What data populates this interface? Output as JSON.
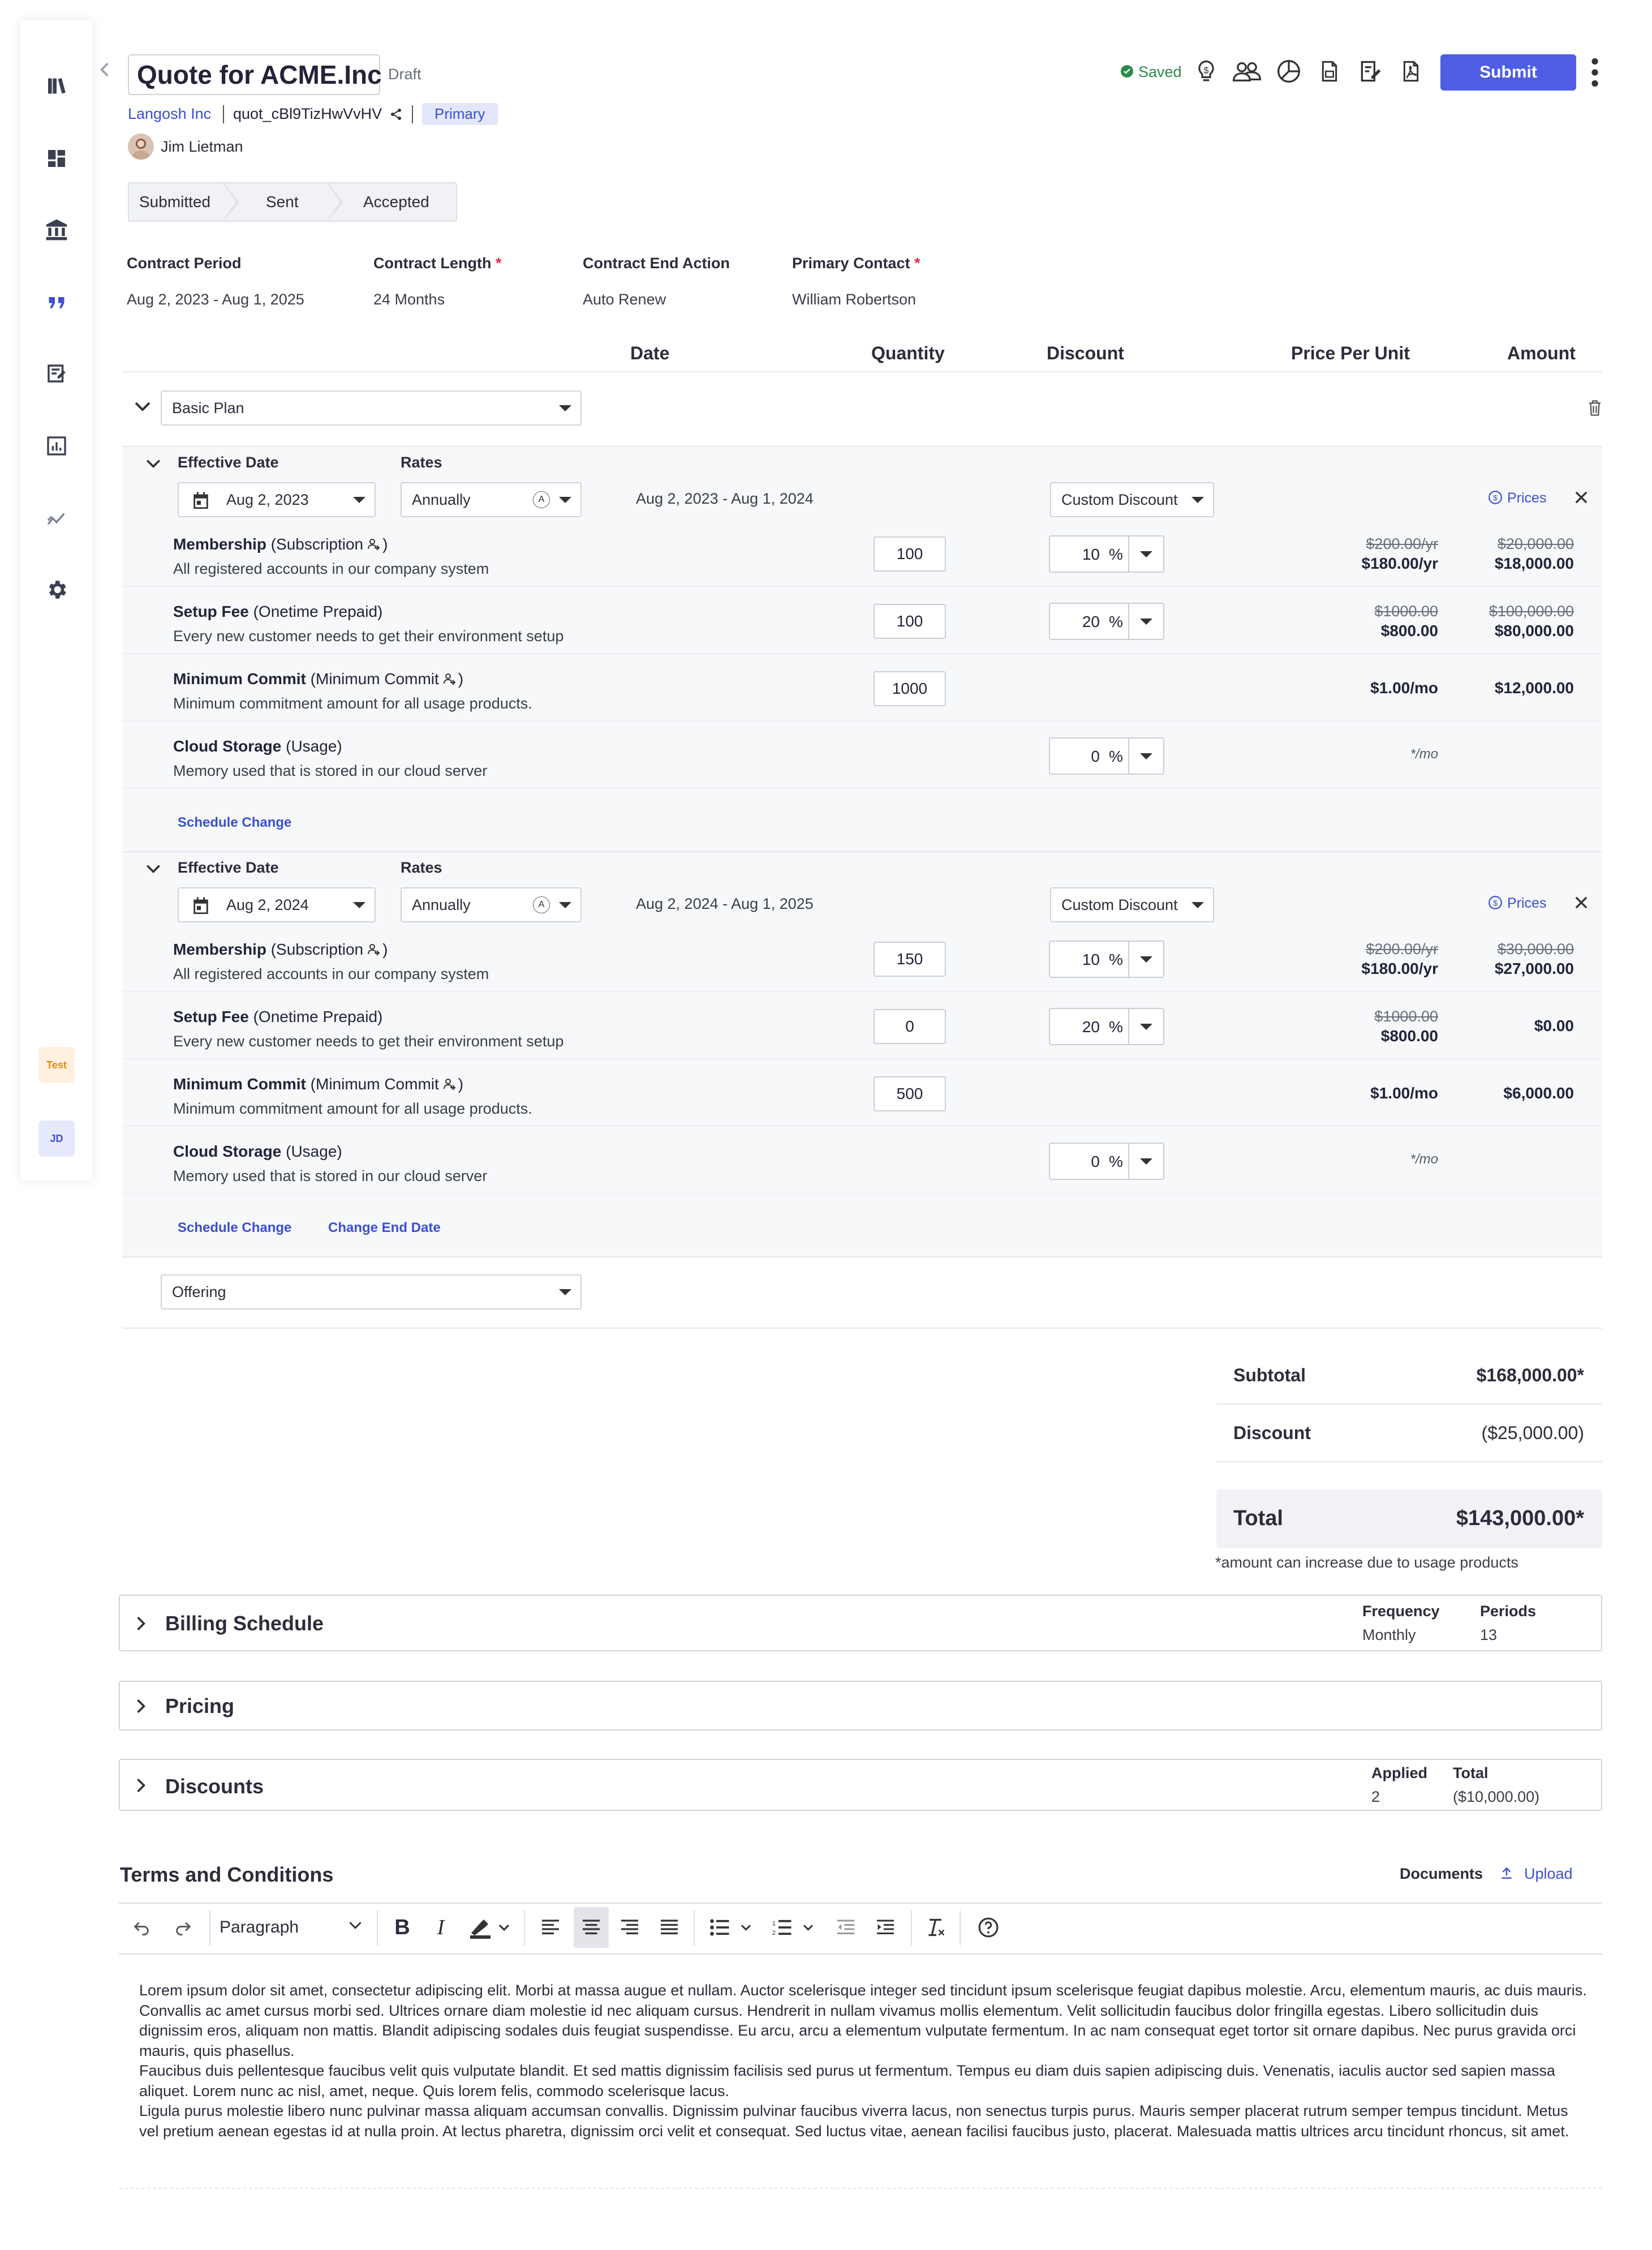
{
  "colors": {
    "accent": "#4f5de4",
    "link": "#3b4fd0",
    "saved": "#2a8a4a",
    "required": "#e0294a",
    "primary_badge_bg": "#e4e7fb",
    "test_badge_bg": "#fff0e0",
    "test_badge_fg": "#e8890c",
    "jd_badge_bg": "#e6e8fb"
  },
  "sidebar": {
    "items": [
      {
        "icon": "library-icon"
      },
      {
        "icon": "dashboard-icon"
      },
      {
        "icon": "bank-icon"
      },
      {
        "icon": "quote-icon"
      },
      {
        "icon": "contract-icon"
      },
      {
        "icon": "report-icon"
      },
      {
        "icon": "analytics-icon"
      },
      {
        "icon": "gear-icon"
      }
    ],
    "badges": {
      "test": "Test",
      "user": "JD"
    }
  },
  "header": {
    "title": "Quote for ACME.Inc",
    "status": "Draft",
    "company": "Langosh Inc",
    "quote_id": "quot_cBl9TizHwVvHV",
    "primary_tag": "Primary",
    "owner": "Jim Lietman",
    "saved": "Saved",
    "submit": "Submit",
    "icons": [
      "idea-icon",
      "users-icon",
      "pie-chart-icon",
      "document-icon",
      "edit-document-icon",
      "pdf-icon"
    ]
  },
  "stages": [
    "Submitted",
    "Sent",
    "Accepted"
  ],
  "contract": {
    "period_label": "Contract Period",
    "period_value": "Aug 2, 2023 - Aug 1, 2025",
    "length_label": "Contract Length",
    "length_value": "24 Months",
    "end_action_label": "Contract End Action",
    "end_action_value": "Auto Renew",
    "contact_label": "Primary Contact",
    "contact_value": "William Robertson",
    "required_mark": "*"
  },
  "columns": {
    "date": "Date",
    "quantity": "Quantity",
    "discount": "Discount",
    "price_per_unit": "Price Per Unit",
    "amount": "Amount"
  },
  "plan": {
    "name": "Basic Plan",
    "offering_placeholder": "Offering"
  },
  "segments": [
    {
      "effective_label": "Effective Date",
      "rates_label": "Rates",
      "date": "Aug 2, 2023",
      "rate": "Annually",
      "rate_badge": "A",
      "range": "Aug 2, 2023 - Aug 1, 2024",
      "discount_type": "Custom Discount",
      "prices": "Prices",
      "items": [
        {
          "name": "Membership",
          "type": "(Subscription",
          "type_end": ")",
          "desc": "All registered accounts in our company system",
          "qty": "100",
          "disc": "10",
          "pct": "%",
          "orig_price": "$200.00/yr",
          "price": "$180.00/yr",
          "orig_amount": "$20,000.00",
          "amount": "$18,000.00"
        },
        {
          "name": "Setup Fee",
          "type": "(Onetime Prepaid)",
          "type_end": "",
          "desc": "Every new customer needs to get their environment setup",
          "qty": "100",
          "disc": "20",
          "pct": "%",
          "orig_price": "$1000.00",
          "price": "$800.00",
          "orig_amount": "$100,000.00",
          "amount": "$80,000.00"
        },
        {
          "name": "Minimum Commit",
          "type": "(Minimum Commit",
          "type_end": ")",
          "desc": "Minimum commitment amount for all usage products.",
          "qty": "1000",
          "disc": "",
          "pct": "",
          "orig_price": "",
          "price": "$1.00/mo",
          "orig_amount": "",
          "amount": "$12,000.00"
        },
        {
          "name": "Cloud Storage",
          "type": "(Usage)",
          "type_end": "",
          "desc": "Memory used that is stored in our cloud server",
          "qty": "",
          "disc": "0",
          "pct": "%",
          "orig_price": "",
          "price": "*/mo",
          "orig_amount": "",
          "amount": ""
        }
      ],
      "links": [
        "Schedule Change"
      ]
    },
    {
      "effective_label": "Effective Date",
      "rates_label": "Rates",
      "date": "Aug 2, 2024",
      "rate": "Annually",
      "rate_badge": "A",
      "range": "Aug 2, 2024 - Aug 1, 2025",
      "discount_type": "Custom Discount",
      "prices": "Prices",
      "items": [
        {
          "name": "Membership",
          "type": "(Subscription",
          "type_end": ")",
          "desc": "All registered accounts in our company system",
          "qty": "150",
          "disc": "10",
          "pct": "%",
          "orig_price": "$200.00/yr",
          "price": "$180.00/yr",
          "orig_amount": "$30,000.00",
          "amount": "$27,000.00"
        },
        {
          "name": "Setup Fee",
          "type": "(Onetime Prepaid)",
          "type_end": "",
          "desc": "Every new customer needs to get their environment setup",
          "qty": "0",
          "disc": "20",
          "pct": "%",
          "orig_price": "$1000.00",
          "price": "$800.00",
          "orig_amount": "",
          "amount": "$0.00"
        },
        {
          "name": "Minimum Commit",
          "type": "(Minimum Commit",
          "type_end": ")",
          "desc": "Minimum commitment amount for all usage products.",
          "qty": "500",
          "disc": "",
          "pct": "",
          "orig_price": "",
          "price": "$1.00/mo",
          "orig_amount": "",
          "amount": "$6,000.00"
        },
        {
          "name": "Cloud Storage",
          "type": "(Usage)",
          "type_end": "",
          "desc": "Memory used that is stored in our cloud server",
          "qty": "",
          "disc": "0",
          "pct": "%",
          "orig_price": "",
          "price": "*/mo",
          "orig_amount": "",
          "amount": ""
        }
      ],
      "links": [
        "Schedule Change",
        "Change End Date"
      ]
    }
  ],
  "summary": {
    "subtotal_label": "Subtotal",
    "subtotal": "$168,000.00*",
    "discount_label": "Discount",
    "discount": "($25,000.00)",
    "total_label": "Total",
    "total": "$143,000.00*",
    "note": "*amount can increase due to usage products"
  },
  "billing": {
    "title": "Billing Schedule",
    "frequency_label": "Frequency",
    "frequency": "Monthly",
    "periods_label": "Periods",
    "periods": "13"
  },
  "pricing": {
    "title": "Pricing"
  },
  "discounts": {
    "title": "Discounts",
    "applied_label": "Applied",
    "applied": "2",
    "total_label": "Total",
    "total": "($10,000.00)"
  },
  "terms": {
    "title": "Terms and Conditions",
    "documents": "Documents",
    "upload": "Upload",
    "paragraph_style": "Paragraph",
    "paragraphs": [
      "Lorem ipsum dolor sit amet, consectetur adipiscing elit. Morbi at massa augue et nullam. Auctor scelerisque integer sed tincidunt ipsum scelerisque feugiat dapibus molestie. Arcu, elementum mauris, ac duis mauris. Convallis ac amet cursus morbi sed. Ultrices ornare diam molestie id nec aliquam cursus. Hendrerit in nullam vivamus mollis elementum. Velit sollicitudin faucibus dolor fringilla egestas. Libero sollicitudin duis dignissim eros, aliquam non mattis. Blandit adipiscing sodales duis feugiat suspendisse. Eu arcu, arcu a elementum vulputate fermentum. In ac nam consequat eget tortor sit ornare dapibus. Nec purus gravida orci mauris, quis phasellus.",
      "Faucibus duis pellentesque faucibus velit quis vulputate blandit. Et sed mattis dignissim facilisis sed purus ut fermentum. Tempus eu diam duis sapien adipiscing duis. Venenatis, iaculis auctor sed sapien massa aliquet. Lorem nunc ac nisl, amet, neque. Quis lorem felis, commodo scelerisque lacus.",
      "Ligula purus molestie libero nunc pulvinar massa aliquam accumsan convallis. Dignissim pulvinar faucibus viverra lacus, non senectus turpis purus. Mauris semper placerat rutrum semper tempus tincidunt. Metus vel pretium aenean egestas id at nulla proin. At lectus pharetra, dignissim orci velit et consequat. Sed luctus vitae, aenean facilisi faucibus justo, placerat. Malesuada mattis ultrices arcu tincidunt rhoncus, sit amet."
    ]
  }
}
